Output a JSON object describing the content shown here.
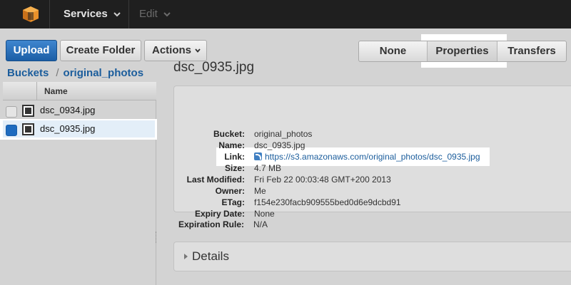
{
  "nav": {
    "logo_icon": "aws-cube-icon",
    "services_label": "Services",
    "edit_label": "Edit"
  },
  "toolbar": {
    "upload_label": "Upload",
    "create_folder_label": "Create Folder",
    "actions_label": "Actions"
  },
  "view_toggle": {
    "none_label": "None",
    "properties_label": "Properties",
    "transfers_label": "Transfers",
    "selected": "Properties"
  },
  "breadcrumb": {
    "root": "Buckets",
    "separator": "/",
    "bucket": "original_photos"
  },
  "file_list": {
    "header_name": "Name",
    "items": [
      {
        "name": "dsc_0934.jpg",
        "checked": false
      },
      {
        "name": "dsc_0935.jpg",
        "checked": true
      }
    ]
  },
  "properties": {
    "title": "dsc_0935.jpg",
    "fields": [
      {
        "key": "Bucket:",
        "value": "original_photos"
      },
      {
        "key": "Name:",
        "value": "dsc_0935.jpg"
      },
      {
        "key": "Link:",
        "value": "https://s3.amazonaws.com/original_photos/dsc_0935.jpg"
      },
      {
        "key": "Size:",
        "value": "4.7 MB"
      },
      {
        "key": "Last Modified:",
        "value": "Fri Feb 22 00:03:48 GMT+200 2013"
      },
      {
        "key": "Owner:",
        "value": "Me"
      },
      {
        "key": "ETag:",
        "value": "f154e230facb909555bed0d6e9dcbd91"
      },
      {
        "key": "Expiry Date:",
        "value": "None"
      },
      {
        "key": "Expiration Rule:",
        "value": "N/A"
      }
    ],
    "details_label": "Details"
  },
  "colors": {
    "topbar": "#1f1f1f",
    "upload_button": "#2a72bd",
    "link": "#1b5d9c",
    "checkbox_checked": "#1e6bbf",
    "logo": "#e8912b"
  }
}
